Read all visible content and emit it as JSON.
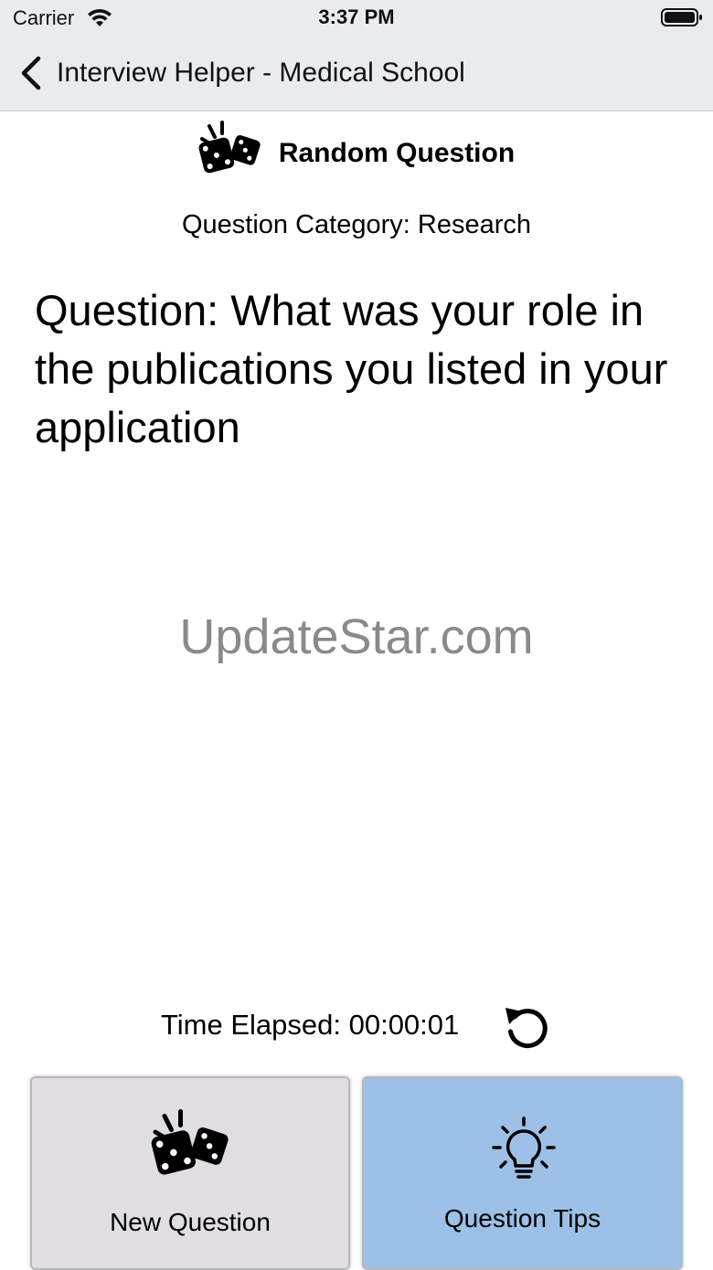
{
  "status_bar": {
    "carrier": "Carrier",
    "time": "3:37 PM",
    "wifi_icon": "wifi-icon",
    "battery_icon": "battery-icon"
  },
  "nav": {
    "back_icon": "chevron-left-icon",
    "title": "Interview Helper - Medical School"
  },
  "header": {
    "icon": "dice-icon",
    "title": "Random Question"
  },
  "category_label": "Question Category: Research",
  "question_text": "Question: What was your role in the publications you listed in your application",
  "watermark": "UpdateStar.com",
  "timer": {
    "text": "Time Elapsed: 00:00:01",
    "reset_icon": "reset-icon"
  },
  "buttons": {
    "new_question": {
      "label": "New Question",
      "icon": "dice-icon"
    },
    "question_tips": {
      "label": "Question Tips",
      "icon": "lightbulb-icon"
    }
  },
  "colors": {
    "bar_background": "#e9ecef",
    "new_question_bg": "#e0dde3",
    "tips_bg": "#9cc0e6",
    "watermark": "#8a8a8a"
  }
}
